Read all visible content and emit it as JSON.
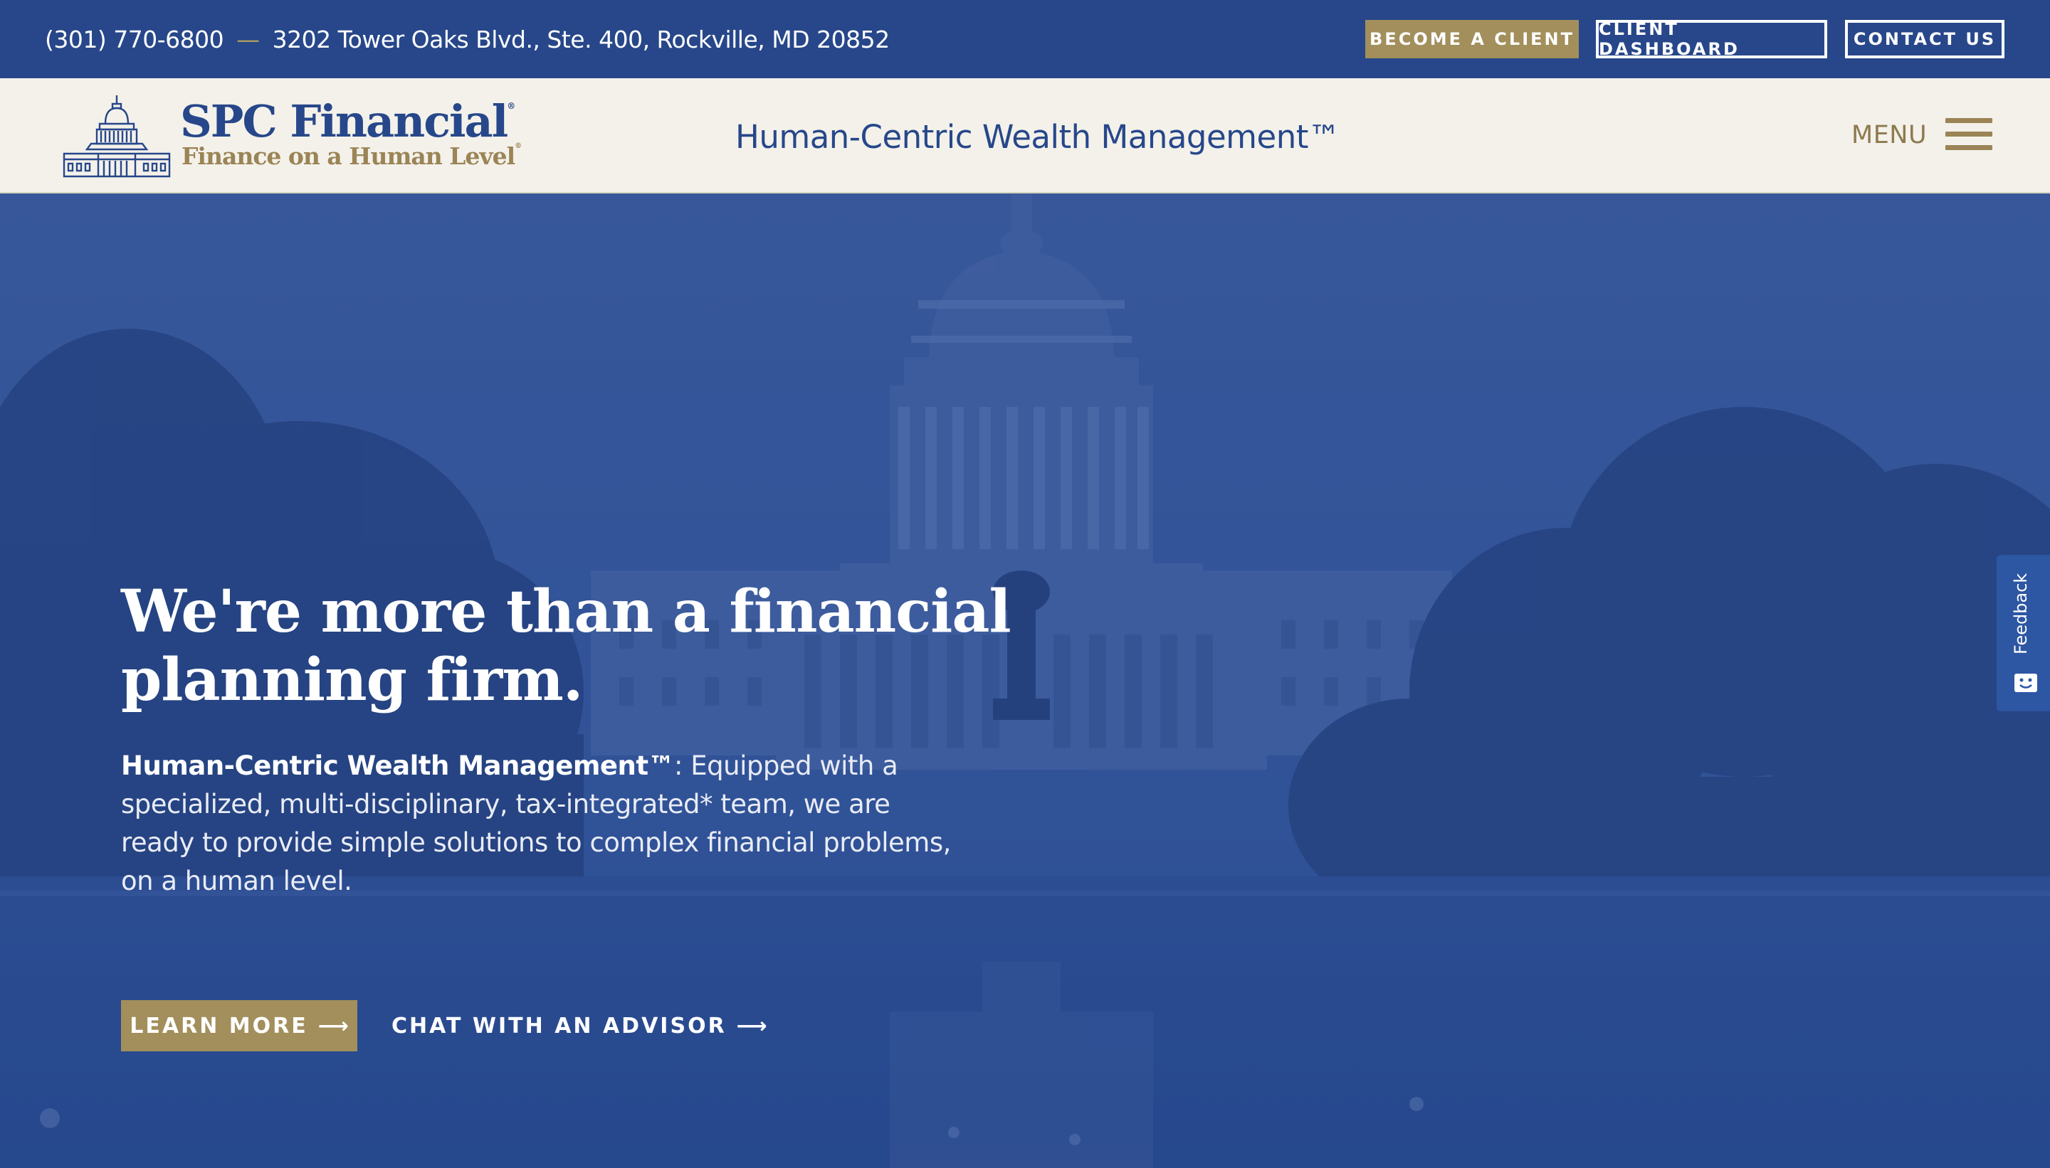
{
  "topbar": {
    "phone": "(301) 770-6800",
    "separator": "—",
    "address": "3202 Tower Oaks Blvd., Ste. 400, Rockville, MD 20852",
    "buttons": {
      "become_client": "BECOME A CLIENT",
      "client_dashboard": "CLIENT DASHBOARD",
      "contact_us": "CONTACT US"
    }
  },
  "header": {
    "logo_name": "SPC Financial",
    "logo_registered": "®",
    "logo_tagline": "Finance on a Human Level",
    "logo_tagline_registered": "®",
    "tagline": "Human-Centric Wealth Management™",
    "menu_label": "MENU"
  },
  "hero": {
    "title": "We're more than a financial planning firm.",
    "body_lead": "Human-Centric Wealth Management™",
    "body_rest": ": Equipped with a specialized, multi-disciplinary, tax-integrated* team, we are ready to provide simple solutions to complex financial problems, on a human level.",
    "learn_more": "LEARN MORE",
    "chat": "CHAT WITH AN ADVISOR",
    "arrow": "⟶"
  },
  "feedback": {
    "label": "Feedback"
  },
  "colors": {
    "navy": "#27478a",
    "gold": "#a38f5c",
    "cream": "#f3f1ea",
    "white": "#ffffff"
  },
  "icons": [
    "capitol-logo-icon",
    "hamburger-menu-icon",
    "arrow-right-icon",
    "feedback-smile-icon"
  ]
}
